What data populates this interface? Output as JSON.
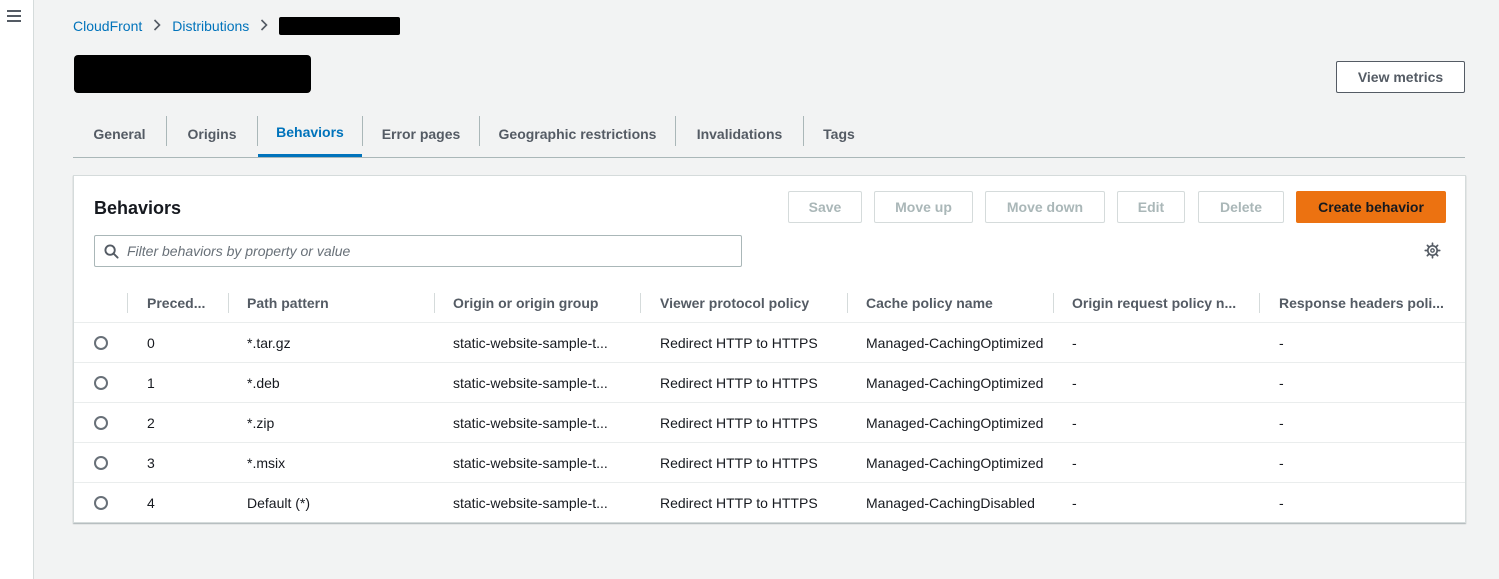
{
  "breadcrumb": {
    "items": [
      "CloudFront",
      "Distributions"
    ]
  },
  "header": {
    "view_metrics_label": "View metrics"
  },
  "tabs": [
    {
      "label": "General"
    },
    {
      "label": "Origins"
    },
    {
      "label": "Behaviors",
      "active": true
    },
    {
      "label": "Error pages"
    },
    {
      "label": "Geographic restrictions"
    },
    {
      "label": "Invalidations"
    },
    {
      "label": "Tags"
    }
  ],
  "panel": {
    "title": "Behaviors",
    "actions": {
      "save": "Save",
      "move_up": "Move up",
      "move_down": "Move down",
      "edit": "Edit",
      "delete": "Delete",
      "create": "Create behavior"
    },
    "filter_placeholder": "Filter behaviors by property or value"
  },
  "table": {
    "columns": [
      "Preced...",
      "Path pattern",
      "Origin or origin group",
      "Viewer protocol policy",
      "Cache policy name",
      "Origin request policy n...",
      "Response headers poli..."
    ],
    "rows": [
      [
        "0",
        "*.tar.gz",
        "static-website-sample-t...",
        "Redirect HTTP to HTTPS",
        "Managed-CachingOptimized",
        "-",
        "-"
      ],
      [
        "1",
        "*.deb",
        "static-website-sample-t...",
        "Redirect HTTP to HTTPS",
        "Managed-CachingOptimized",
        "-",
        "-"
      ],
      [
        "2",
        "*.zip",
        "static-website-sample-t...",
        "Redirect HTTP to HTTPS",
        "Managed-CachingOptimized",
        "-",
        "-"
      ],
      [
        "3",
        "*.msix",
        "static-website-sample-t...",
        "Redirect HTTP to HTTPS",
        "Managed-CachingOptimized",
        "-",
        "-"
      ],
      [
        "4",
        "Default (*)",
        "static-website-sample-t...",
        "Redirect HTTP to HTTPS",
        "Managed-CachingDisabled",
        "-",
        "-"
      ]
    ]
  },
  "colors": {
    "link": "#0073bb",
    "primary": "#ec7211",
    "background": "#f2f3f3"
  },
  "icons": {
    "menu": "hamburger-menu-icon",
    "separator": "chevron-right-icon",
    "search": "search-icon",
    "settings": "gear-icon"
  }
}
